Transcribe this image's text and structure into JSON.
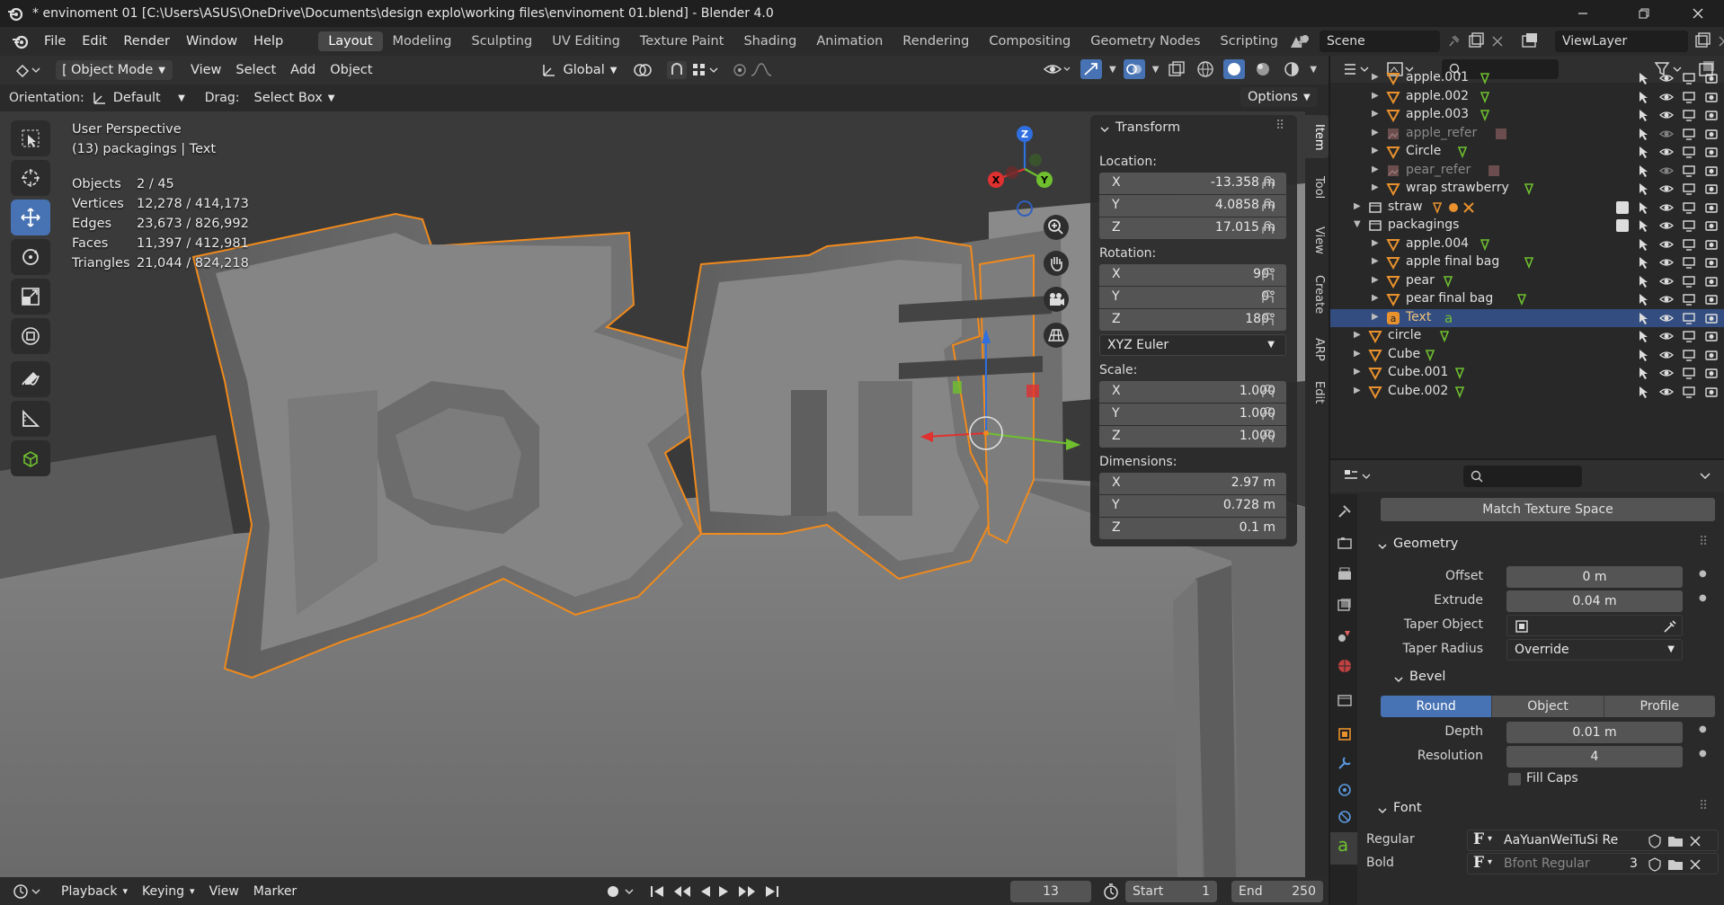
{
  "window": {
    "title": "* envinoment 01 [C:\\Users\\ASUS\\OneDrive\\Documents\\design explo\\working files\\envinoment 01.blend] - Blender 4.0"
  },
  "menus": [
    "File",
    "Edit",
    "Render",
    "Window",
    "Help"
  ],
  "workspaces": [
    "Layout",
    "Modeling",
    "Sculpting",
    "UV Editing",
    "Texture Paint",
    "Shading",
    "Animation",
    "Rendering",
    "Compositing",
    "Geometry Nodes",
    "Scripting"
  ],
  "active_workspace": "Layout",
  "scene": {
    "label": "Scene",
    "viewlayer": "ViewLayer"
  },
  "header": {
    "mode": "Object Mode",
    "menus": [
      "View",
      "Select",
      "Add",
      "Object"
    ],
    "transform_orientation": "Global"
  },
  "subheader": {
    "orientation_label": "Orientation:",
    "orientation_value": "Default",
    "drag_label": "Drag:",
    "drag_value": "Select Box",
    "options": "Options"
  },
  "viewport": {
    "perspective": "User Perspective",
    "context": "(13) packagings | Text",
    "stats": [
      {
        "k": "Objects",
        "v": "2 / 45"
      },
      {
        "k": "Vertices",
        "v": "12,278 / 414,173"
      },
      {
        "k": "Edges",
        "v": "23,673 / 826,992"
      },
      {
        "k": "Faces",
        "v": "11,397 / 412,981"
      },
      {
        "k": "Triangles",
        "v": "21,044 / 824,218"
      }
    ],
    "gizmo": {
      "x": "X",
      "y": "Y",
      "z": "Z"
    }
  },
  "npanel": {
    "title": "Transform",
    "location_label": "Location:",
    "location": {
      "x": "-13.358 m",
      "y": "4.0858 m",
      "z": "17.015 m"
    },
    "rotation_label": "Rotation:",
    "rotation": {
      "x": "90°",
      "y": "0°",
      "z": "180°"
    },
    "rotation_mode": "XYZ Euler",
    "scale_label": "Scale:",
    "scale": {
      "x": "1.000",
      "y": "1.000",
      "z": "1.000"
    },
    "dimensions_label": "Dimensions:",
    "dimensions": {
      "x": "2.97 m",
      "y": "0.728 m",
      "z": "0.1 m"
    },
    "axis": {
      "x": "X",
      "y": "Y",
      "z": "Z"
    },
    "tabs": [
      "Item",
      "Tool",
      "View",
      "Create",
      "ARP",
      "Edit"
    ]
  },
  "outliner": {
    "rows": [
      {
        "name": "apple.001",
        "kind": "mesh",
        "dim": false
      },
      {
        "name": "apple.002",
        "kind": "mesh",
        "dim": false
      },
      {
        "name": "apple.003",
        "kind": "mesh",
        "dim": false
      },
      {
        "name": "apple_refer",
        "kind": "image",
        "dim": true
      },
      {
        "name": "Circle",
        "kind": "mesh",
        "dim": false
      },
      {
        "name": "pear_refer",
        "kind": "image",
        "dim": true
      },
      {
        "name": "wrap strawberry",
        "kind": "mesh",
        "dim": false
      },
      {
        "name": "straw",
        "kind": "collection",
        "dim": false
      },
      {
        "name": "packagings",
        "kind": "collection",
        "dim": false
      },
      {
        "name": "apple.004",
        "kind": "mesh",
        "dim": false
      },
      {
        "name": "apple final bag",
        "kind": "mesh",
        "dim": false
      },
      {
        "name": "pear",
        "kind": "mesh",
        "dim": false
      },
      {
        "name": "pear final bag",
        "kind": "mesh",
        "dim": false
      },
      {
        "name": "Text",
        "kind": "text",
        "dim": false
      },
      {
        "name": "circle",
        "kind": "mesh",
        "dim": false
      },
      {
        "name": "Cube",
        "kind": "mesh",
        "dim": false
      },
      {
        "name": "Cube.001",
        "kind": "mesh",
        "dim": false
      },
      {
        "name": "Cube.002",
        "kind": "mesh",
        "dim": false
      }
    ]
  },
  "properties": {
    "match_texture_space": "Match Texture Space",
    "geometry_title": "Geometry",
    "offset_label": "Offset",
    "offset": "0 m",
    "extrude_label": "Extrude",
    "extrude": "0.04 m",
    "taper_object_label": "Taper Object",
    "taper_radius_label": "Taper Radius",
    "taper_radius": "Override",
    "bevel_title": "Bevel",
    "bevel_modes": [
      "Round",
      "Object",
      "Profile"
    ],
    "depth_label": "Depth",
    "depth": "0.01 m",
    "resolution_label": "Resolution",
    "resolution": "4",
    "fill_caps_label": "Fill Caps",
    "font_title": "Font",
    "regular_label": "Regular",
    "regular_font": "AaYuanWeiTuSi Re...",
    "bold_label": "Bold",
    "bold_font": "Bfont Regular",
    "bold_users": "3"
  },
  "timeline": {
    "menus": [
      "Playback",
      "Keying",
      "View",
      "Marker"
    ],
    "frame": "13",
    "start_label": "Start",
    "start": "1",
    "end_label": "End",
    "end": "250"
  },
  "colors": {
    "accent": "#4772b3",
    "selected_outline": "#f08a1c",
    "selected_row": "#334d80"
  }
}
